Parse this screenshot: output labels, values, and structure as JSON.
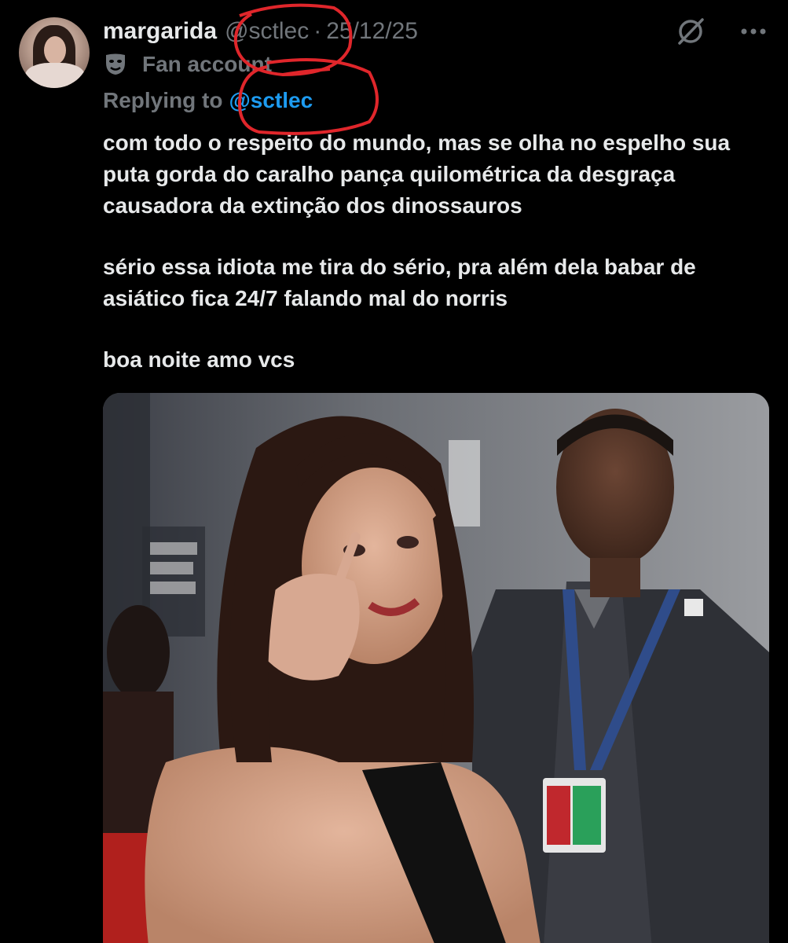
{
  "post": {
    "author_name": "margarida",
    "author_handle": "@sctlec",
    "separator": "·",
    "date": "25/12/25",
    "label": "Fan account",
    "replying_prefix": "Replying to",
    "replying_handle": "@sctlec",
    "paragraphs": [
      "com todo o respeito do mundo, mas se olha no espelho sua puta gorda do caralho pança quilométrica da desgraça causadora da extinção dos dinossauros",
      "sério essa idiota me tira do sério, pra além dela babar de asiático fica 24/7 falando mal do norris",
      "boa noite amo vcs"
    ]
  },
  "icons": {
    "label_icon": "theater-mask-icon",
    "grok_icon": "grok-icon",
    "more_icon": "more-horizontal-icon"
  },
  "colors": {
    "background": "#000000",
    "text": "#e7e9ea",
    "muted": "#71767b",
    "link": "#1d9bf0",
    "annotation": "#e0262b"
  }
}
